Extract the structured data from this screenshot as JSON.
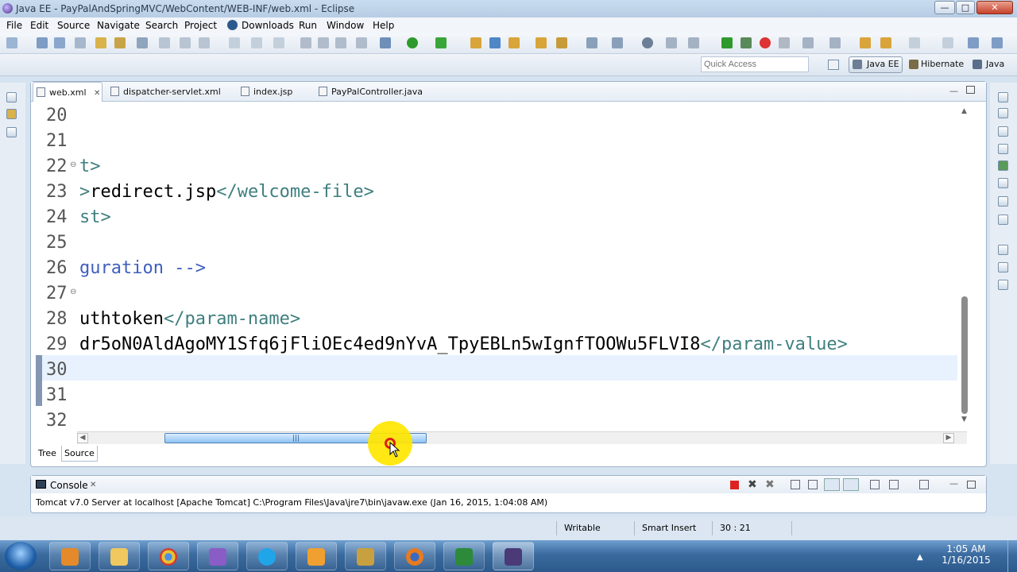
{
  "window": {
    "title": "Java EE - PayPalAndSpringMVC/WebContent/WEB-INF/web.xml - Eclipse",
    "minimize": "—",
    "maximize": "□",
    "close": "✕"
  },
  "menu": [
    "File",
    "Edit",
    "Source",
    "Navigate",
    "Search",
    "Project",
    "Downloads",
    "Run",
    "Window",
    "Help"
  ],
  "quick_access": {
    "placeholder": "Quick Access"
  },
  "perspectives": [
    "Java EE",
    "Hibernate",
    "Java"
  ],
  "editor": {
    "tabs": [
      {
        "label": "web.xml",
        "close": "✕"
      },
      {
        "label": "dispatcher-servlet.xml"
      },
      {
        "label": "index.jsp"
      },
      {
        "label": "PayPalController.java"
      }
    ],
    "lines": [
      {
        "num": "20",
        "parts": []
      },
      {
        "num": "21",
        "parts": []
      },
      {
        "num": "22",
        "parts": [
          {
            "t": "tag",
            "v": "t>"
          }
        ]
      },
      {
        "num": "23",
        "parts": [
          {
            "t": "tag",
            "v": ">"
          },
          {
            "t": "txt",
            "v": "redirect.jsp"
          },
          {
            "t": "tag",
            "v": "</welcome-file>"
          }
        ]
      },
      {
        "num": "24",
        "parts": [
          {
            "t": "tag",
            "v": "st>"
          }
        ]
      },
      {
        "num": "25",
        "parts": []
      },
      {
        "num": "26",
        "parts": [
          {
            "t": "cmt",
            "v": "guration -->"
          }
        ]
      },
      {
        "num": "27",
        "parts": []
      },
      {
        "num": "28",
        "parts": [
          {
            "t": "txt",
            "v": "uthtoken"
          },
          {
            "t": "tag",
            "v": "</param-name>"
          }
        ]
      },
      {
        "num": "29",
        "parts": [
          {
            "t": "txt",
            "v": "dr5oN0AldAgoMY1Sfq6jFliOEc4ed9nYvA_TpyEBLn5wIgnfTOOWu5FLVI8"
          },
          {
            "t": "tag",
            "v": "</param-value>"
          }
        ]
      },
      {
        "num": "30",
        "parts": []
      },
      {
        "num": "31",
        "parts": []
      },
      {
        "num": "32",
        "parts": []
      }
    ],
    "bottom_tabs": [
      "Tree",
      "Source"
    ]
  },
  "console": {
    "tab_label": "Console",
    "tab_close": "✕",
    "text": "Tomcat v7.0 Server at localhost [Apache Tomcat] C:\\Program Files\\Java\\jre7\\bin\\javaw.exe (Jan 16, 2015, 1:04:08 AM)"
  },
  "status": {
    "writable": "Writable",
    "insert_mode": "Smart Insert",
    "position": "30 : 21"
  },
  "taskbar": {
    "time": "1:05 AM",
    "date": "1/16/2015"
  },
  "colors": {
    "tag": "#3f7f7f",
    "comment": "#3f5fbf",
    "current_line": "#e8f2fe",
    "cursor_highlight": "#ffe600"
  }
}
